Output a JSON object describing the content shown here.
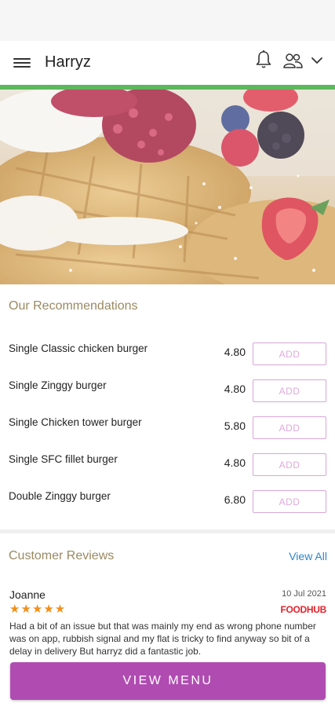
{
  "app": {
    "store_name": "Harryz",
    "colors": {
      "accent_green": "#5cb85c",
      "brand_purple": "#b04cb1",
      "section_title": "#9a8a62",
      "link_blue": "#2f86c6",
      "star_orange": "#f28f1a",
      "source_red": "#e3232b"
    },
    "icons": [
      "menu-icon",
      "bell-icon",
      "users-icon",
      "chevron-down-icon"
    ]
  },
  "recommendations": {
    "title": "Our Recommendations",
    "items": [
      {
        "name": "Single Classic chicken burger",
        "price": "4.80",
        "add_label": "ADD"
      },
      {
        "name": "Single Zinggy burger",
        "price": "4.80",
        "add_label": "ADD"
      },
      {
        "name": "Single Chicken tower burger",
        "price": "5.80",
        "add_label": "ADD"
      },
      {
        "name": "Single SFC fillet burger",
        "price": "4.80",
        "add_label": "ADD"
      },
      {
        "name": "Double Zinggy burger",
        "price": "6.80",
        "add_label": "ADD"
      }
    ]
  },
  "reviews": {
    "title": "Customer Reviews",
    "view_all_label": "View All",
    "items": [
      {
        "author": "Joanne",
        "date": "10 Jul 2021",
        "rating": 5,
        "stars": "★★★★★",
        "source": "FOODHUB",
        "text": "Had a bit of an issue but that was mainly my end as wrong phone number was on app, rubbish signal and my flat is tricky to find anyway so bit of a delay in delivery But harryz did a fantastic job."
      }
    ]
  },
  "footer": {
    "view_menu_label": "VIEW MENU"
  }
}
